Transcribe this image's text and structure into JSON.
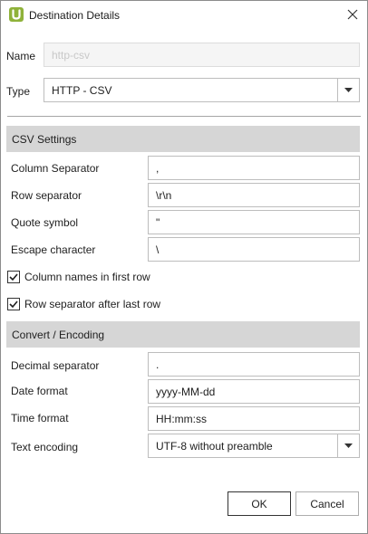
{
  "window": {
    "title": "Destination Details"
  },
  "general": {
    "name_label": "Name",
    "name_value": "http-csv",
    "type_label": "Type",
    "type_value": "HTTP - CSV"
  },
  "csv_settings": {
    "header": "CSV Settings",
    "column_separator_label": "Column Separator",
    "column_separator_value": ",",
    "row_separator_label": "Row separator",
    "row_separator_value": "\\r\\n",
    "quote_symbol_label": "Quote symbol",
    "quote_symbol_value": "\"",
    "escape_character_label": "Escape character",
    "escape_character_value": "\\",
    "column_names_label": "Column names in first row",
    "column_names_checked": true,
    "row_separator_after_label": "Row separator after last row",
    "row_separator_after_checked": true
  },
  "encoding": {
    "header": "Convert / Encoding",
    "decimal_separator_label": "Decimal separator",
    "decimal_separator_value": ".",
    "date_format_label": "Date format",
    "date_format_value": "yyyy-MM-dd",
    "time_format_label": "Time format",
    "time_format_value": "HH:mm:ss",
    "text_encoding_label": "Text encoding",
    "text_encoding_value": "UTF-8 without preamble"
  },
  "buttons": {
    "ok": "OK",
    "cancel": "Cancel"
  },
  "colors": {
    "accent": "#8fb23a",
    "section_bg": "#d6d6d6"
  },
  "icons": {
    "app": "app-logo-icon",
    "close": "close-icon",
    "dropdown": "chevron-down-icon",
    "check": "check-icon"
  }
}
